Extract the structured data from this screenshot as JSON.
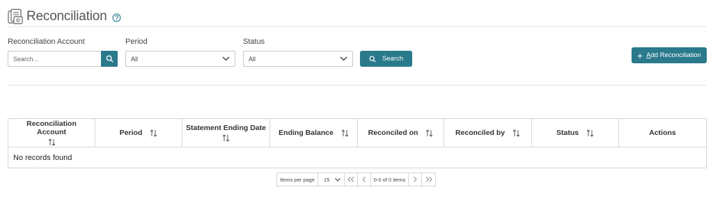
{
  "header": {
    "title": "Reconciliation",
    "icon": "reconciliation-doc-icon",
    "help_icon": "help-circle-icon"
  },
  "filters": {
    "account": {
      "label": "Reconciliation Account",
      "placeholder": "Search..."
    },
    "period": {
      "label": "Period",
      "value": "All"
    },
    "status": {
      "label": "Status",
      "value": "All"
    },
    "search_button": "Search"
  },
  "add_button": "Add Reconciliation",
  "table": {
    "columns": [
      {
        "label": "Reconciliation Account",
        "sortable": true
      },
      {
        "label": "Period",
        "sortable": true
      },
      {
        "label": "Statement Ending Date",
        "sortable": true
      },
      {
        "label": "Ending Balance",
        "sortable": true
      },
      {
        "label": "Reconciled on",
        "sortable": true
      },
      {
        "label": "Reconciled by",
        "sortable": true
      },
      {
        "label": "Status",
        "sortable": true
      },
      {
        "label": "Actions",
        "sortable": false
      }
    ],
    "empty_message": "No records found"
  },
  "pagination": {
    "items_per_page_label": "Items per page",
    "page_size": "15",
    "range_text": "0-0 of 0 items"
  },
  "colors": {
    "accent": "#2a7a8c",
    "border": "#d6d6d6",
    "text": "#333333"
  }
}
